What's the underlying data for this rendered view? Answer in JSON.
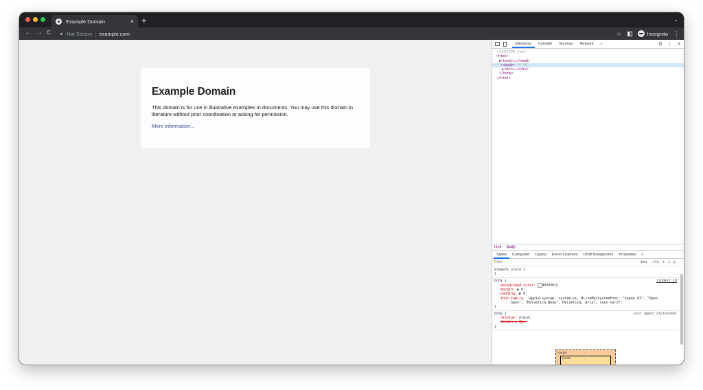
{
  "browser": {
    "tab": {
      "title": "Example Domain",
      "close": "×"
    },
    "new_tab": "+",
    "tab_menu": "⌄",
    "nav": {
      "back": "←",
      "forward": "→",
      "reload": "C"
    },
    "omnibox": {
      "security_icon": "warning-icon",
      "security_label": "Not Secure",
      "separator": "|",
      "url": "example.com"
    },
    "actions": {
      "bookmark": "☆",
      "incognito_label": "Incognito",
      "menu": "⋮"
    },
    "traffic_lights": [
      "#ff5f57",
      "#febc2e",
      "#28c840"
    ]
  },
  "page": {
    "background": "#f0f0f2",
    "heading": "Example Domain",
    "paragraph": "This domain is for use in illustrative examples in documents. You may use this domain in literature without prior coordination or asking for permission.",
    "link": "More information..."
  },
  "devtools": {
    "tabs": [
      "Elements",
      "Console",
      "Sources",
      "Network",
      "»"
    ],
    "active_tab": "Elements",
    "tree": {
      "doctype": "<!DOCTYPE html>",
      "html_open": "<html>",
      "head": "▶<head>…</head>",
      "body_prefix": "··· ▼",
      "body_open": "<body>",
      "body_suffix": " == $0",
      "div": "▶<div>…</div>",
      "body_close": "</body>",
      "html_close": "</html>"
    },
    "breadcrumbs": [
      "html",
      "body"
    ],
    "styles_tabs": [
      "Styles",
      "Computed",
      "Layout",
      "Event Listeners",
      "DOM Breakpoints",
      "Properties",
      "»"
    ],
    "filter_placeholder": "Filter",
    "filter_buttons": [
      ":hov",
      ".cls",
      "+"
    ],
    "rules": {
      "element_style": "element.style {",
      "element_close": "}",
      "body_selector": "body {",
      "body_source": "(index):10",
      "bg_prop": "background-color:",
      "bg_val": "#f0f0f2;",
      "margin_prop": "margin:",
      "margin_val": "▶ 0;",
      "padding_prop": "padding:",
      "padding_val": "▶ 0;",
      "font_prop": "font-family:",
      "font_val": "-apple-system, system-ui, BlinkMacSystemFont, \"Segoe UI\", \"Open",
      "font_val_cont": "Sans\", \"Helvetica Neue\", Helvetica, Arial, sans-serif;",
      "body_close": "}",
      "ua_selector": "body {",
      "ua_source": "user agent stylesheet",
      "display_prop": "display:",
      "display_val": "block;",
      "ua_margin": "margin:▶ 8px;",
      "ua_close": "}"
    },
    "box_model": {
      "margin_label": "margin",
      "border_label": "border",
      "dash": "-"
    }
  }
}
